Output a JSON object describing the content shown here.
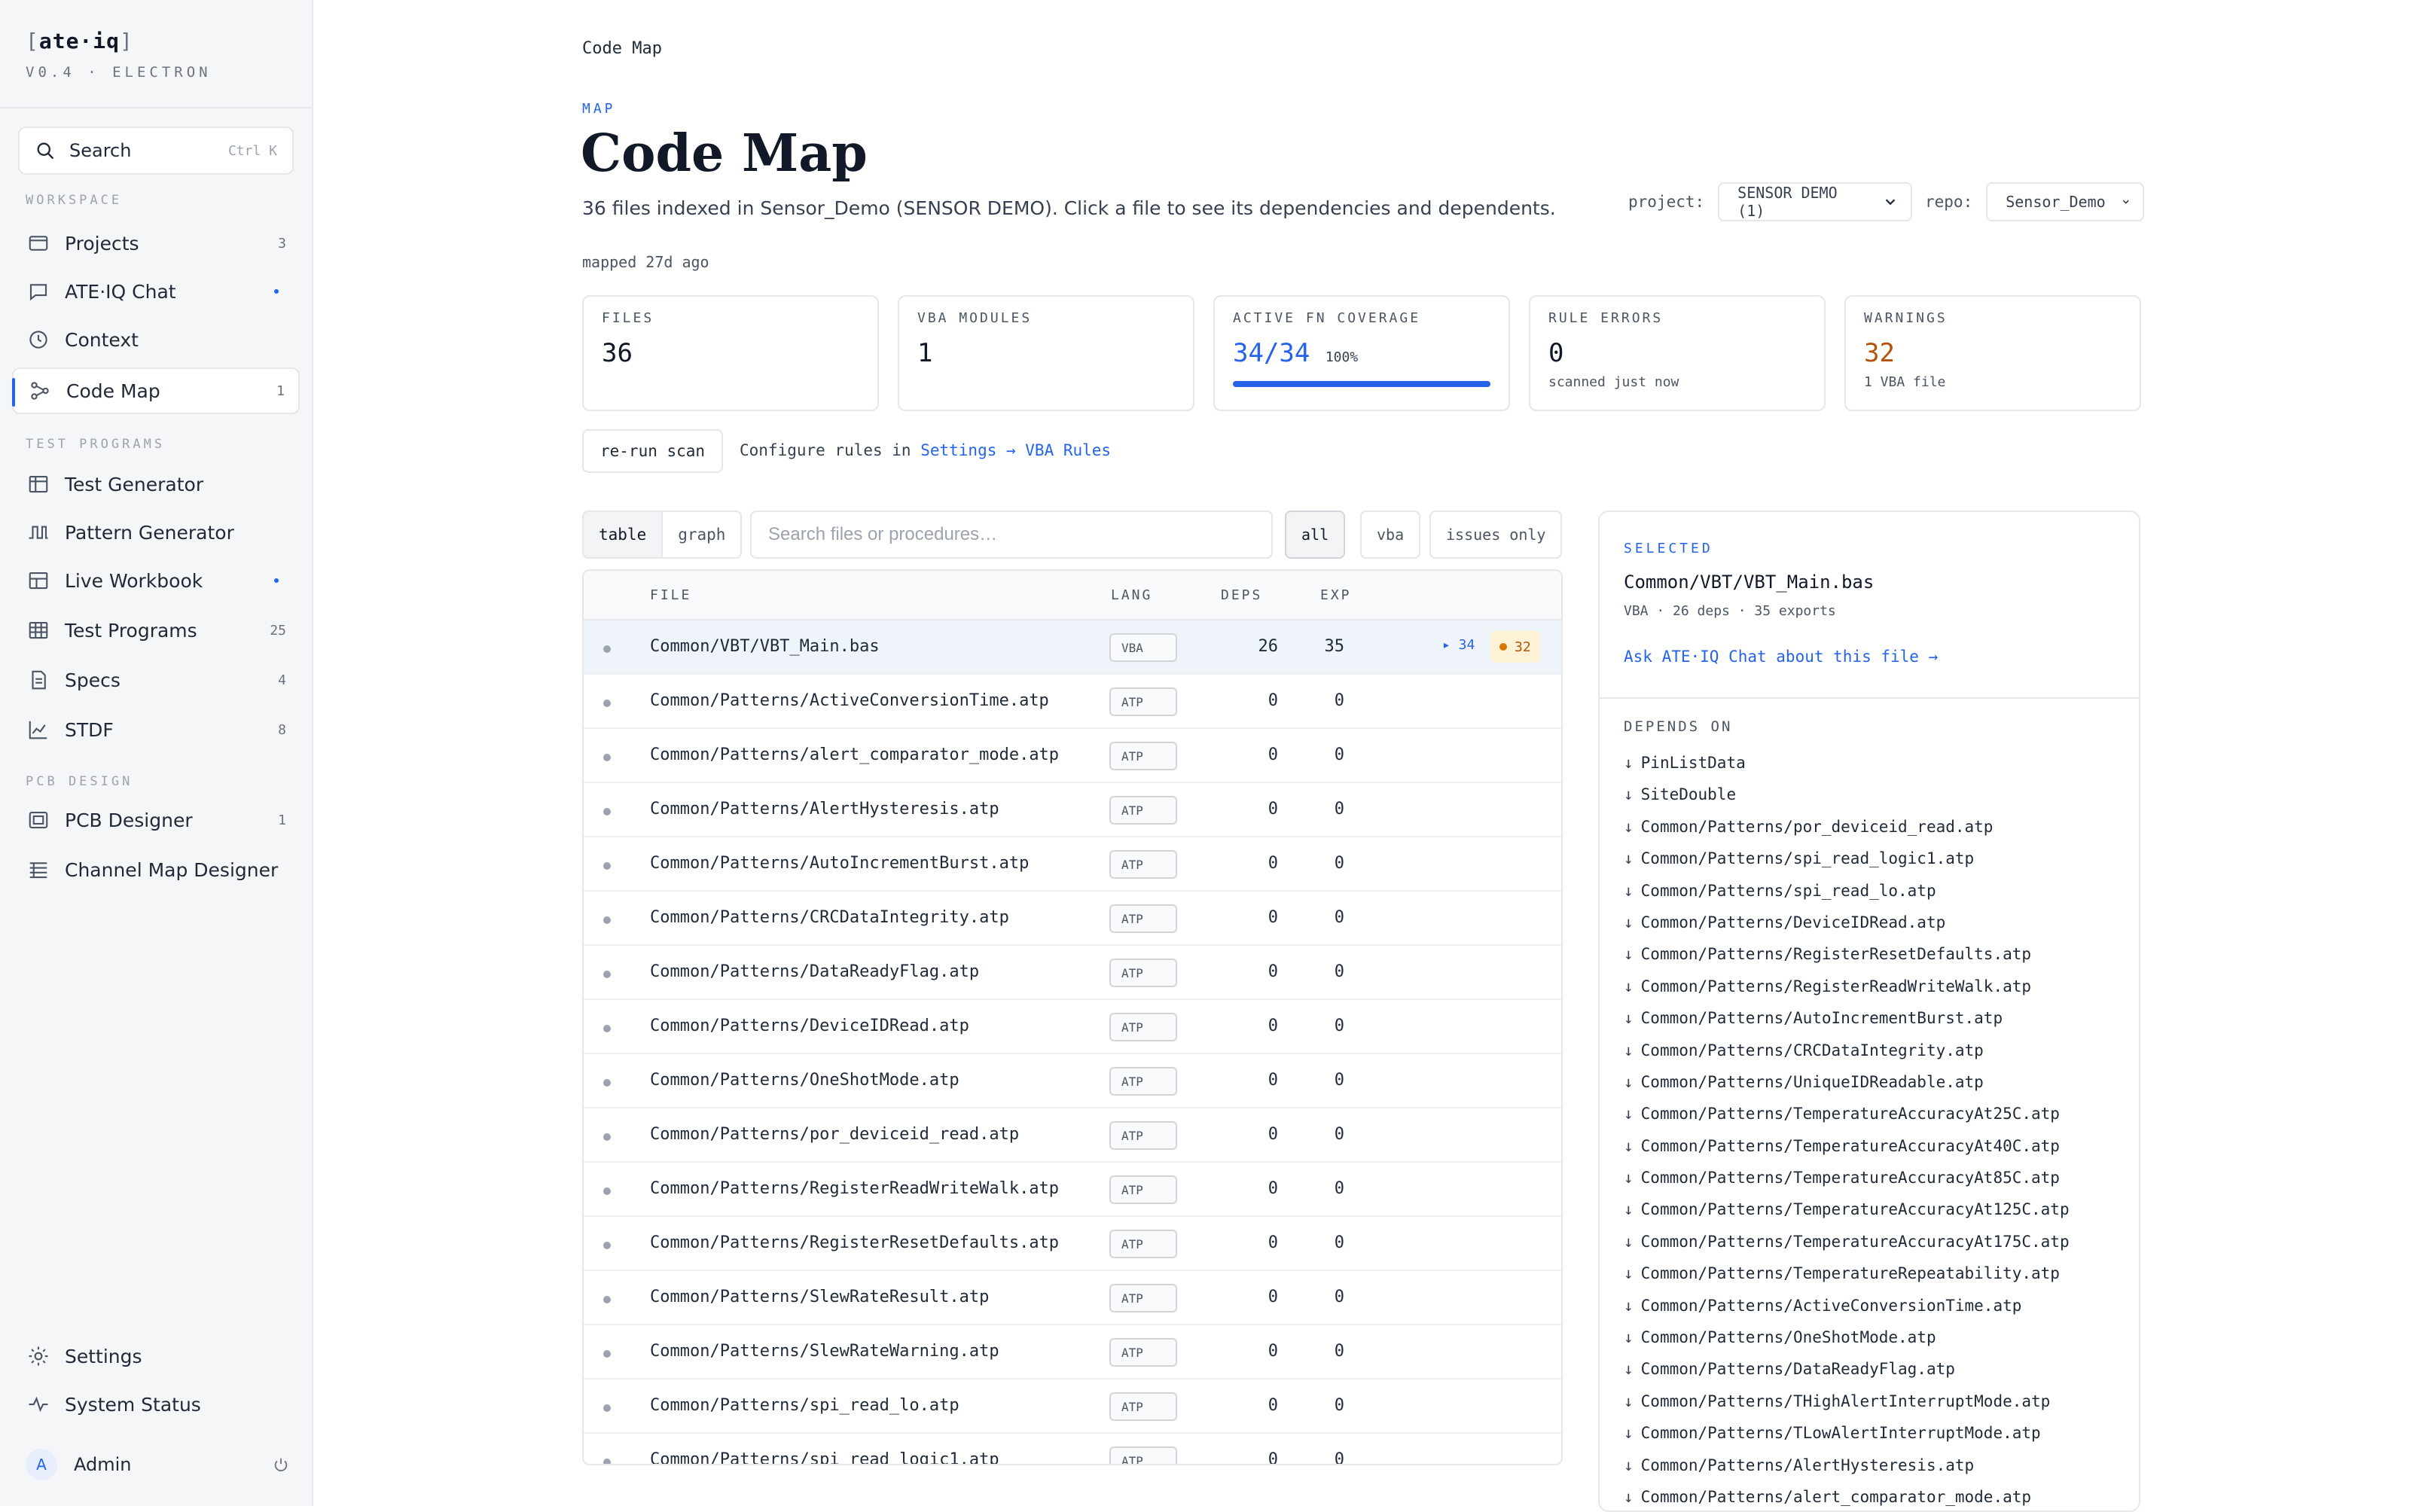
{
  "brand": {
    "name": "ate·iq",
    "version": "V0.4 · ELECTRON"
  },
  "search": {
    "label": "Search",
    "shortcut": "Ctrl K"
  },
  "sidebar": {
    "workspace_label": "WORKSPACE",
    "test_programs_label": "TEST PROGRAMS",
    "pcb_label": "PCB DESIGN",
    "items": [
      {
        "label": "Projects",
        "count": "3",
        "icon": "folder-icon"
      },
      {
        "label": "ATE·IQ Chat",
        "count": "",
        "icon": "chat-icon"
      },
      {
        "label": "Context",
        "count": "",
        "icon": "clock-icon"
      },
      {
        "label": "Code Map",
        "count": "1",
        "icon": "graph-icon"
      },
      {
        "label": "Test Generator",
        "count": "",
        "icon": "grid-icon"
      },
      {
        "label": "Pattern Generator",
        "count": "",
        "icon": "waveform-icon"
      },
      {
        "label": "Live Workbook",
        "count": "",
        "icon": "table-icon"
      },
      {
        "label": "Test Programs",
        "count": "25",
        "icon": "spreadsheet-icon"
      },
      {
        "label": "Specs",
        "count": "4",
        "icon": "document-icon"
      },
      {
        "label": "STDF",
        "count": "8",
        "icon": "chart-icon"
      },
      {
        "label": "PCB Designer",
        "count": "1",
        "icon": "board-icon"
      },
      {
        "label": "Channel Map Designer",
        "count": "",
        "icon": "list-icon"
      }
    ],
    "settings": "Settings",
    "system_status": "System Status",
    "user": {
      "initial": "A",
      "name": "Admin"
    }
  },
  "page": {
    "breadcrumb": "Code Map",
    "eyebrow": "MAP",
    "title": "Code Map",
    "subtitle": "36 files indexed in Sensor_Demo (SENSOR DEMO). Click a file to see its dependencies and dependents.",
    "mapped": "mapped 27d ago",
    "project_label": "project:",
    "project_value": "SENSOR DEMO (1)",
    "repo_label": "repo:",
    "repo_value": "Sensor_Demo"
  },
  "stats": {
    "files": {
      "label": "FILES",
      "value": "36"
    },
    "vba": {
      "label": "VBA MODULES",
      "value": "1"
    },
    "coverage": {
      "label": "ACTIVE FN COVERAGE",
      "value": "34/34",
      "pct": "100%",
      "fraction": 1.0
    },
    "errors": {
      "label": "RULE ERRORS",
      "value": "0",
      "sub": "scanned just now"
    },
    "warnings": {
      "label": "WARNINGS",
      "value": "32",
      "sub": "1 VBA file"
    }
  },
  "actions": {
    "rerun": "re-run scan",
    "config_prefix": "Configure rules in ",
    "config_link": "Settings → VBA Rules"
  },
  "filters": {
    "view_table": "table",
    "view_graph": "graph",
    "search_placeholder": "Search files or procedures…",
    "all": "all",
    "vba": "vba",
    "issues": "issues only"
  },
  "table": {
    "headers": {
      "file": "FILE",
      "lang": "LANG",
      "deps": "DEPS",
      "exp": "EXP"
    },
    "rows": [
      {
        "file": "Common/VBT/VBT_Main.bas",
        "lang": "VBA",
        "deps": "26",
        "exp": "35",
        "badge_fn": "▸ 34",
        "badge_warn": "32"
      },
      {
        "file": "Common/Patterns/ActiveConversionTime.atp",
        "lang": "ATP",
        "deps": "0",
        "exp": "0"
      },
      {
        "file": "Common/Patterns/alert_comparator_mode.atp",
        "lang": "ATP",
        "deps": "0",
        "exp": "0"
      },
      {
        "file": "Common/Patterns/AlertHysteresis.atp",
        "lang": "ATP",
        "deps": "0",
        "exp": "0"
      },
      {
        "file": "Common/Patterns/AutoIncrementBurst.atp",
        "lang": "ATP",
        "deps": "0",
        "exp": "0"
      },
      {
        "file": "Common/Patterns/CRCDataIntegrity.atp",
        "lang": "ATP",
        "deps": "0",
        "exp": "0"
      },
      {
        "file": "Common/Patterns/DataReadyFlag.atp",
        "lang": "ATP",
        "deps": "0",
        "exp": "0"
      },
      {
        "file": "Common/Patterns/DeviceIDRead.atp",
        "lang": "ATP",
        "deps": "0",
        "exp": "0"
      },
      {
        "file": "Common/Patterns/OneShotMode.atp",
        "lang": "ATP",
        "deps": "0",
        "exp": "0"
      },
      {
        "file": "Common/Patterns/por_deviceid_read.atp",
        "lang": "ATP",
        "deps": "0",
        "exp": "0"
      },
      {
        "file": "Common/Patterns/RegisterReadWriteWalk.atp",
        "lang": "ATP",
        "deps": "0",
        "exp": "0"
      },
      {
        "file": "Common/Patterns/RegisterResetDefaults.atp",
        "lang": "ATP",
        "deps": "0",
        "exp": "0"
      },
      {
        "file": "Common/Patterns/SlewRateResult.atp",
        "lang": "ATP",
        "deps": "0",
        "exp": "0"
      },
      {
        "file": "Common/Patterns/SlewRateWarning.atp",
        "lang": "ATP",
        "deps": "0",
        "exp": "0"
      },
      {
        "file": "Common/Patterns/spi_read_lo.atp",
        "lang": "ATP",
        "deps": "0",
        "exp": "0"
      },
      {
        "file": "Common/Patterns/spi_read_logic1.atp",
        "lang": "ATP",
        "deps": "0",
        "exp": "0"
      }
    ]
  },
  "panel": {
    "tag": "SELECTED",
    "file": "Common/VBT/VBT_Main.bas",
    "meta": "VBA · 26 deps · 35 exports",
    "ask": "Ask ATE·IQ Chat about this file →",
    "depends_label": "DEPENDS ON",
    "arrow": "↓",
    "depends": [
      "PinListData",
      "SiteDouble",
      "Common/Patterns/por_deviceid_read.atp",
      "Common/Patterns/spi_read_logic1.atp",
      "Common/Patterns/spi_read_lo.atp",
      "Common/Patterns/DeviceIDRead.atp",
      "Common/Patterns/RegisterResetDefaults.atp",
      "Common/Patterns/RegisterReadWriteWalk.atp",
      "Common/Patterns/AutoIncrementBurst.atp",
      "Common/Patterns/CRCDataIntegrity.atp",
      "Common/Patterns/UniqueIDReadable.atp",
      "Common/Patterns/TemperatureAccuracyAt25C.atp",
      "Common/Patterns/TemperatureAccuracyAt40C.atp",
      "Common/Patterns/TemperatureAccuracyAt85C.atp",
      "Common/Patterns/TemperatureAccuracyAt125C.atp",
      "Common/Patterns/TemperatureAccuracyAt175C.atp",
      "Common/Patterns/TemperatureRepeatability.atp",
      "Common/Patterns/ActiveConversionTime.atp",
      "Common/Patterns/OneShotMode.atp",
      "Common/Patterns/DataReadyFlag.atp",
      "Common/Patterns/THighAlertInterruptMode.atp",
      "Common/Patterns/TLowAlertInterruptMode.atp",
      "Common/Patterns/AlertHysteresis.atp",
      "Common/Patterns/alert_comparator_mode.atp"
    ]
  },
  "colors": {
    "accent": "#2563eb",
    "warning": "#b45309",
    "selected_row": "#eff4fb"
  }
}
